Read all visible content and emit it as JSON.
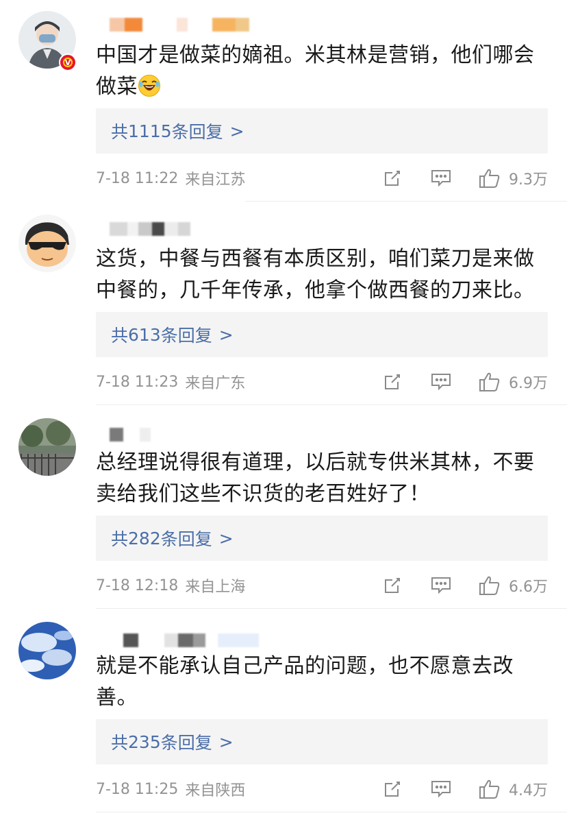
{
  "comments": [
    {
      "text": "中国才是做菜的嫡祖。米其林是营销，他们哪会做菜",
      "emoji": "laughing-crying-emoji",
      "verified": true,
      "replies_prefix": "共",
      "replies_count": "1115",
      "replies_suffix": "条回复",
      "replies_arrow": ">",
      "time": "7-18 11:22",
      "location": "来自江苏",
      "likes": "9.3万"
    },
    {
      "text": "这货，中餐与西餐有本质区别，咱们菜刀是来做中餐的，几千年传承，他拿个做西餐的刀来比。",
      "verified": false,
      "replies_prefix": "共",
      "replies_count": "613",
      "replies_suffix": "条回复",
      "replies_arrow": ">",
      "time": "7-18 11:23",
      "location": "来自广东",
      "likes": "6.9万"
    },
    {
      "text": "总经理说得很有道理，以后就专供米其林，不要卖给我们这些不识货的老百姓好了！",
      "verified": false,
      "replies_prefix": "共",
      "replies_count": "282",
      "replies_suffix": "条回复",
      "replies_arrow": ">",
      "time": "7-18 12:18",
      "location": "来自上海",
      "likes": "6.6万"
    },
    {
      "text": "就是不能承认自己产品的问题，也不愿意去改善。",
      "verified": false,
      "replies_prefix": "共",
      "replies_count": "235",
      "replies_suffix": "条回复",
      "replies_arrow": ">",
      "time": "7-18 11:25",
      "location": "来自陕西",
      "likes": "4.4万"
    }
  ],
  "icons": {
    "share": "share-icon",
    "comment": "comment-icon",
    "like": "thumbs-up-icon",
    "verified": "verified-badge-icon"
  },
  "colors": {
    "reply_link": "#4a6ea8",
    "meta": "#939393",
    "reply_bg": "#f4f4f4",
    "verified_badge": "#e6162d"
  }
}
